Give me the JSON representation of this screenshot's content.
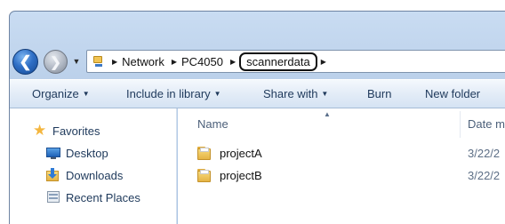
{
  "address": {
    "crumbs": [
      "Network",
      "PC4050"
    ],
    "current": "scannerdata"
  },
  "toolbar": {
    "organize": "Organize",
    "include_in_library": "Include in library",
    "share_with": "Share with",
    "burn": "Burn",
    "new_folder": "New folder"
  },
  "nav": {
    "favorites": "Favorites",
    "desktop": "Desktop",
    "downloads": "Downloads",
    "recent_places": "Recent Places"
  },
  "columns": {
    "name": "Name",
    "date": "Date m"
  },
  "files": [
    {
      "name": "projectA",
      "date": "3/22/2"
    },
    {
      "name": "projectB",
      "date": "3/22/2"
    }
  ],
  "icons": [
    "back-arrow-icon",
    "forward-arrow-icon",
    "computer-icon",
    "star-icon",
    "desktop-icon",
    "downloads-icon",
    "recent-places-icon",
    "folder-icon"
  ],
  "colors": {
    "accent": "#2f6fc6",
    "toolbar_text": "#1e395b",
    "favorites_star": "#f4b63f"
  }
}
